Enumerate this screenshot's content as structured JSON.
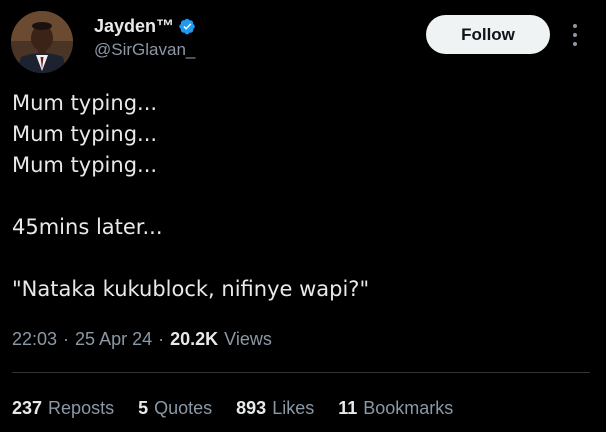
{
  "author": {
    "display_name": "Jayden™",
    "handle": "@SirGlavan_",
    "verified": true
  },
  "follow_label": "Follow",
  "tweet": {
    "lines": [
      "Mum typing...",
      "Mum typing...",
      "Mum typing...",
      "",
      "45mins later...",
      "",
      "\"Nataka kukublock, nifinye wapi?\""
    ]
  },
  "meta": {
    "time": "22:03",
    "separator": "·",
    "date": "25 Apr 24",
    "views_count": "20.2K",
    "views_label": "Views"
  },
  "stats": {
    "reposts": {
      "count": "237",
      "label": "Reposts"
    },
    "quotes": {
      "count": "5",
      "label": "Quotes"
    },
    "likes": {
      "count": "893",
      "label": "Likes"
    },
    "bookmarks": {
      "count": "11",
      "label": "Bookmarks"
    }
  },
  "colors": {
    "background": "#000000",
    "text": "#e7e9ea",
    "secondary": "#8b98a5",
    "verified_badge": "#1d9bf0",
    "follow_bg": "#eff3f4"
  },
  "icons": {
    "verified": "verified-badge-icon",
    "more": "more-options-icon"
  }
}
